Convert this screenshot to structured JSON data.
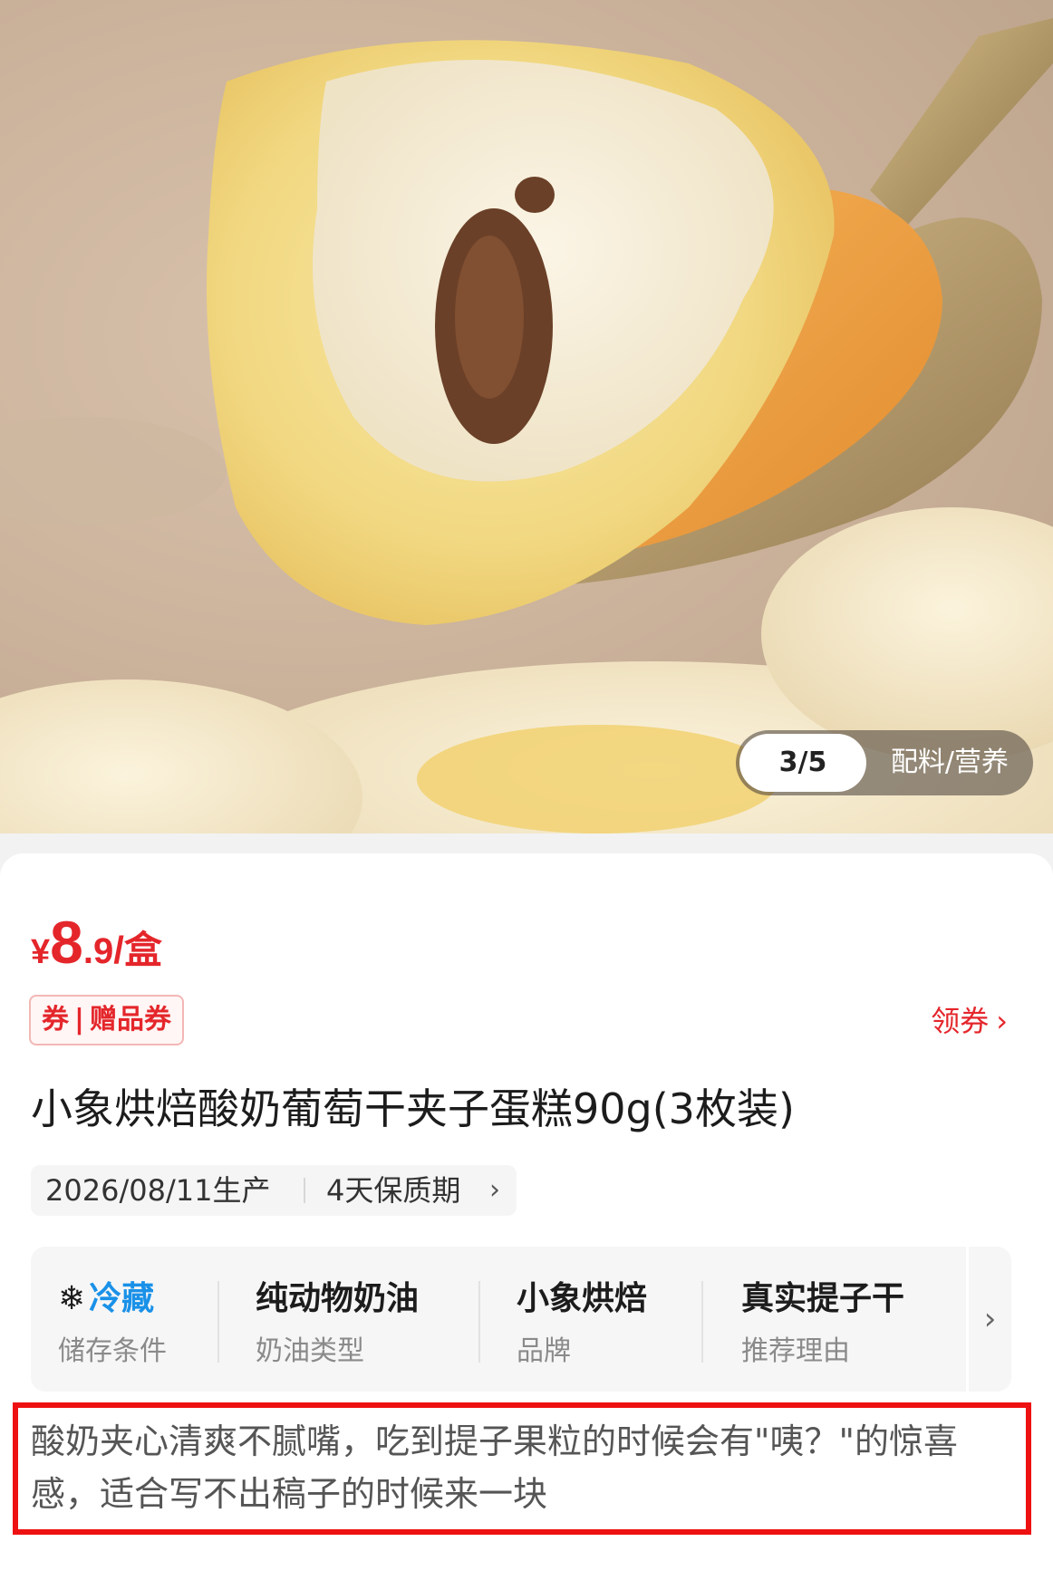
{
  "gallery": {
    "counter": "3/5",
    "tab_label": "配料/营养"
  },
  "price": {
    "currency": "¥",
    "integer": "8",
    "decimal": ".9",
    "unit": "/盒"
  },
  "coupon": {
    "tag_left": "券",
    "tag_sep": "|",
    "tag_right": "赠品券",
    "action_label": "领券",
    "action_chevron": "›"
  },
  "product": {
    "title": "小象烘焙酸奶葡萄干夹子蛋糕90g(3枚装)",
    "production_date": "2026/08/11生产",
    "shelf_life": "4天保质期",
    "shelf_chevron": "›"
  },
  "attributes": [
    {
      "icon": "snowflake-icon",
      "icon_glyph": "❄",
      "value": "冷藏",
      "label": "储存条件"
    },
    {
      "value": "纯动物奶油",
      "label": "奶油类型"
    },
    {
      "value": "小象烘焙",
      "label": "品牌"
    },
    {
      "value": "真实提子干",
      "label": "推荐理由"
    }
  ],
  "attributes_more": "›",
  "description": "酸奶夹心清爽不腻嘴，吃到提子果粒的时候会有\"咦？\"的惊喜感，适合写不出稿子的时候来一块",
  "colors": {
    "price_red": "#e4262b",
    "cold_blue": "#1a91e8",
    "highlight_red": "#ee1111"
  }
}
